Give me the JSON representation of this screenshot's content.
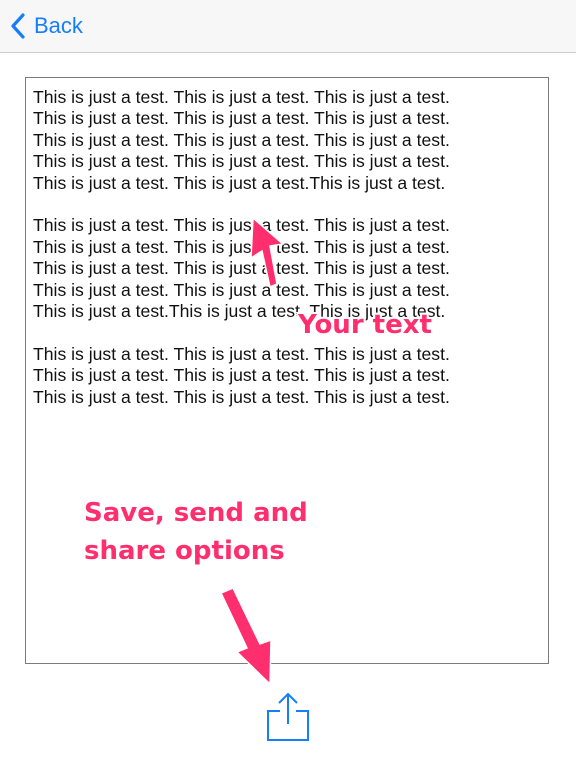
{
  "nav": {
    "back_label": "Back"
  },
  "document": {
    "text": "This is just a test. This is just a test. This is just a test.\nThis is just a test. This is just a test. This is just a test.\nThis is just a test. This is just a test. This is just a test.\nThis is just a test. This is just a test. This is just a test.\nThis is just a test. This is just a test.This is just a test.\n\nThis is just a test. This is just a test. This is just a test.\nThis is just a test. This is just a test. This is just a test.\nThis is just a test. This is just a test. This is just a test.\nThis is just a test. This is just a test. This is just a test.\nThis is just a test.This is just a test. This is just a test.\n\nThis is just a test. This is just a test. This is just a test.\nThis is just a test. This is just a test. This is just a test.\nThis is just a test. This is just a test. This is just a test."
  },
  "annotations": {
    "your_text": "Your text",
    "save_line1": "Save, send and",
    "save_line2": "share options"
  },
  "colors": {
    "accent": "#157efb",
    "annotation": "#ff2e6e"
  },
  "icons": {
    "back": "chevron-left-icon",
    "share": "share-icon"
  }
}
